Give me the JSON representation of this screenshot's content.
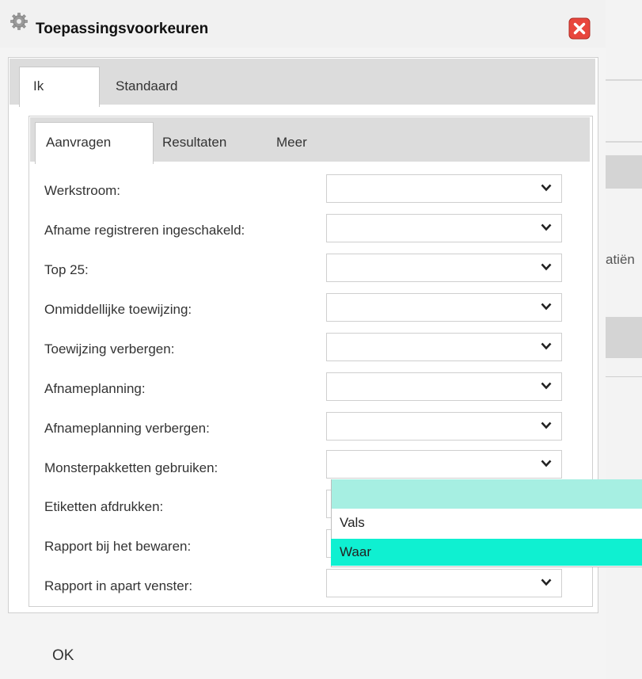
{
  "window": {
    "title": "Toepassingsvoorkeuren",
    "icons": {
      "title_icon": "gear-icon",
      "close": "close-icon"
    },
    "close_color": "#e8463d"
  },
  "outer_tabs": [
    {
      "label": "Ik",
      "active": true
    },
    {
      "label": "Standaard",
      "active": false
    }
  ],
  "inner_tabs": [
    {
      "label": "Aanvragen",
      "active": true
    },
    {
      "label": "Resultaten",
      "active": false
    },
    {
      "label": "Meer",
      "active": false
    }
  ],
  "fields": [
    {
      "label": "Werkstroom:",
      "value": ""
    },
    {
      "label": "Afname registreren ingeschakeld:",
      "value": ""
    },
    {
      "label": "Top 25:",
      "value": ""
    },
    {
      "label": "Onmiddellijke toewijzing:",
      "value": ""
    },
    {
      "label": "Toewijzing verbergen:",
      "value": ""
    },
    {
      "label": "Afnameplanning:",
      "value": ""
    },
    {
      "label": "Afnameplanning verbergen:",
      "value": ""
    },
    {
      "label": "Monsterpakketten gebruiken:",
      "value": ""
    },
    {
      "label": "Etiketten afdrukken:",
      "value": ""
    },
    {
      "label": "Rapport bij het bewaren:",
      "value": ""
    },
    {
      "label": "Rapport in apart venster:",
      "value": ""
    }
  ],
  "open_dropdown": {
    "field": "Etiketten afdrukken:",
    "options": [
      "",
      "Vals",
      "Waar"
    ],
    "highlighted": "Waar"
  },
  "buttons": {
    "ok": "OK"
  },
  "background": {
    "partial_text": "atiën"
  },
  "colors": {
    "highlight": "#0ff0d1",
    "selected_blank": "#a6efe2"
  }
}
